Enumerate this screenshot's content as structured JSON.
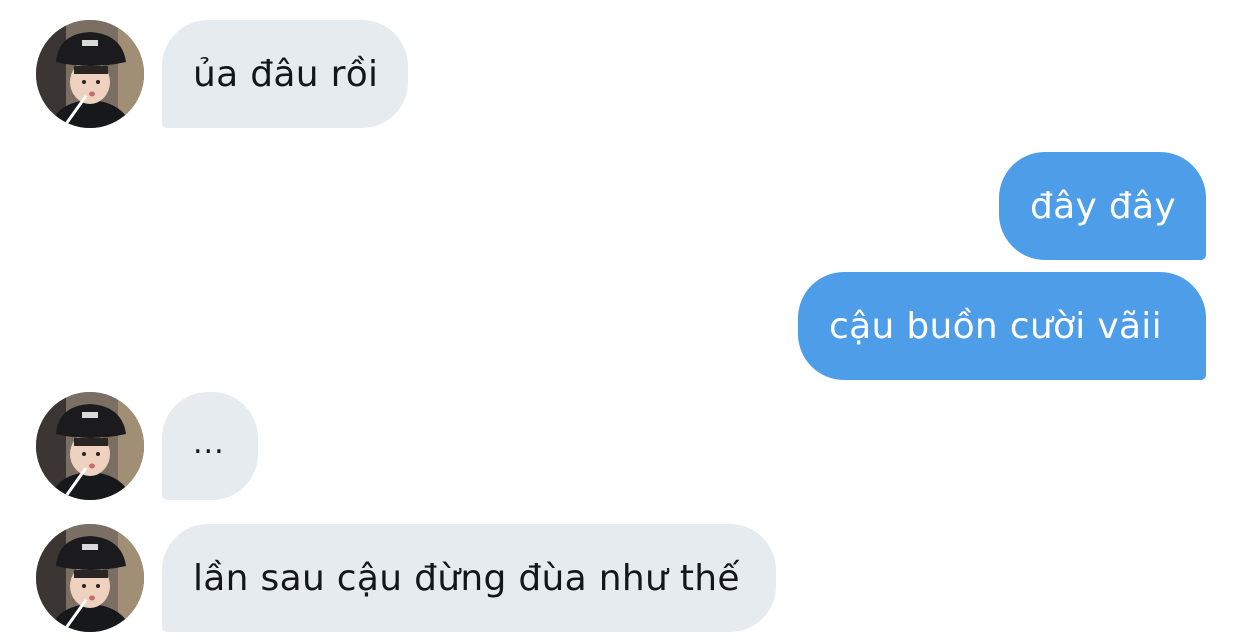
{
  "conversation": {
    "messages": [
      {
        "direction": "incoming",
        "text": "ủa đâu rồi"
      },
      {
        "direction": "outgoing",
        "text": "đây đây"
      },
      {
        "direction": "outgoing",
        "text": "cậu buồn cười vãii"
      },
      {
        "direction": "incoming",
        "text": "..."
      },
      {
        "direction": "incoming",
        "text": "lần sau cậu đừng đùa như thế"
      }
    ]
  },
  "colors": {
    "incoming_bubble": "#e6ebf0",
    "outgoing_bubble": "#4d9de9",
    "incoming_text": "#14171a",
    "outgoing_text": "#ffffff"
  },
  "icons": {
    "contact_avatar": "contact-avatar-photo"
  }
}
